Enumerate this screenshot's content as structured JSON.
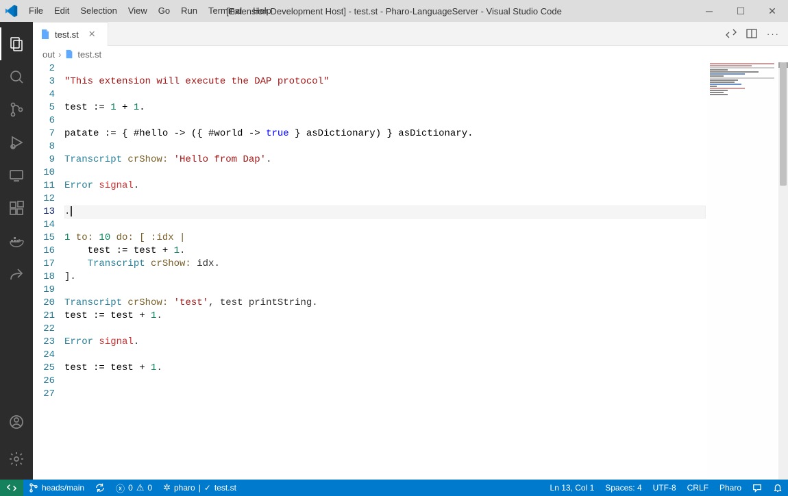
{
  "window": {
    "title": "[Extension Development Host] - test.st - Pharo-LanguageServer - Visual Studio Code"
  },
  "menus": {
    "file": "File",
    "edit": "Edit",
    "selection": "Selection",
    "view": "View",
    "go": "Go",
    "run": "Run",
    "terminal": "Terminal",
    "help": "Help"
  },
  "tab": {
    "label": "test.st"
  },
  "breadcrumbs": {
    "seg0": "out",
    "seg1": "test.st"
  },
  "gutter": {
    "lines": [
      "2",
      "3",
      "4",
      "5",
      "6",
      "7",
      "8",
      "9",
      "10",
      "11",
      "12",
      "13",
      "14",
      "15",
      "16",
      "17",
      "18",
      "19",
      "20",
      "21",
      "22",
      "23",
      "24",
      "25",
      "26",
      "27"
    ],
    "current_index": 11
  },
  "code": {
    "l2": "",
    "l3_str": "\"This extension will execute the DAP protocol\"",
    "l4": "",
    "l5_a": "test := ",
    "l5_n1": "1",
    "l5_b": " + ",
    "l5_n2": "1",
    "l5_c": ".",
    "l6": "",
    "l7_a": "patate := { #hello -> ({ #world -> ",
    "l7_kw": "true",
    "l7_b": " } asDictionary) } asDictionary.",
    "l8": "",
    "l9_t": "Transcript",
    "l9_fn": " crShow:",
    "l9_sp": " ",
    "l9_s": "'Hello from Dap'",
    "l9_d": ".",
    "l10": "",
    "l11_e": "Error",
    "l11_s": " signal",
    "l11_d": ".",
    "l12": "",
    "l13": ".",
    "l14": "",
    "l15_a": "1",
    "l15_b": " to: ",
    "l15_c": "10",
    "l15_d": " do: [ :idx |",
    "l16_a": "    test := test + ",
    "l16_n": "1",
    "l16_d": ".",
    "l17_t": "    Transcript",
    "l17_fn": " crShow:",
    "l17_b": " idx.",
    "l18": "].",
    "l19": "",
    "l20_t": "Transcript",
    "l20_fn": " crShow:",
    "l20_sp": " ",
    "l20_s": "'test'",
    "l20_b": ", test printString.",
    "l21_a": "test := test + ",
    "l21_n": "1",
    "l21_d": ".",
    "l22": "",
    "l23_e": "Error",
    "l23_s": " signal",
    "l23_d": ".",
    "l24": "",
    "l25_a": "test := test + ",
    "l25_n": "1",
    "l25_d": ".",
    "l26": "",
    "l27": ""
  },
  "status": {
    "branch": "heads/main",
    "errors": "0",
    "warnings": "0",
    "pharo": "pharo",
    "file": "test.st",
    "position": "Ln 13, Col 1",
    "spaces": "Spaces: 4",
    "encoding": "UTF-8",
    "eol": "CRLF",
    "language": "Pharo"
  }
}
